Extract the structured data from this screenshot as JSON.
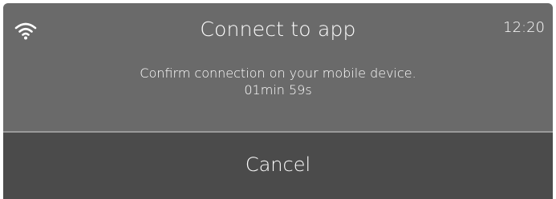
{
  "header": {
    "title": "Connect to app",
    "time": "12:20",
    "status_icon": "wifi-icon"
  },
  "message": {
    "line1": "Confirm connection on your mobile device.",
    "countdown": "01min 59s"
  },
  "actions": {
    "cancel_label": "Cancel"
  },
  "colors": {
    "panel_background": "#6a6a6a",
    "button_background": "#4b4b4b",
    "divider": "#9a9a9a",
    "text": "#ffffff"
  }
}
